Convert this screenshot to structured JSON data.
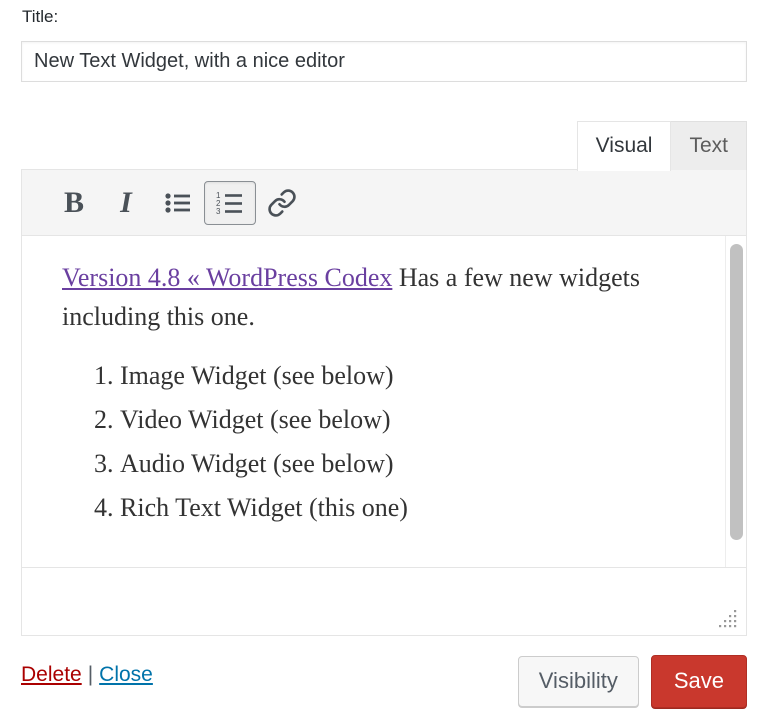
{
  "title_field": {
    "label": "Title:",
    "value": "New Text Widget, with a nice editor",
    "placeholder": "Title"
  },
  "tabs": [
    {
      "label": "Visual",
      "active": true,
      "name": "tab-visual"
    },
    {
      "label": "Text",
      "active": false,
      "name": "tab-text"
    }
  ],
  "toolbar": {
    "bold": {
      "label": "B",
      "icon": "bold-icon",
      "active": false
    },
    "italic": {
      "label": "I",
      "icon": "italic-icon",
      "active": false
    },
    "bullet_list": {
      "label": "",
      "icon": "unordered-list-icon",
      "active": false
    },
    "numbered_list": {
      "label": "",
      "icon": "ordered-list-icon",
      "active": true
    },
    "link": {
      "label": "",
      "icon": "link-icon",
      "active": false
    }
  },
  "editor": {
    "paragraph": {
      "link_text": "Version 4.8 « WordPress Codex",
      "rest_text": " Has a few new widgets including this one."
    },
    "list_items": [
      "Image Widget (see below)",
      "Video Widget (see below)",
      "Audio Widget (see below)",
      "Rich Text Widget (this one)"
    ],
    "resize_handle_icon": "resize-grip-icon",
    "scrollbar_icon": "vertical-scrollbar"
  },
  "footer": {
    "delete_label": "Delete",
    "separator": "|",
    "close_label": "Close",
    "visibility_label": "Visibility",
    "save_label": "Save"
  },
  "colors": {
    "save_button": "#c9382d",
    "delete_link": "#aa0000",
    "close_link": "#0073aa",
    "content_link": "#6a3fa0",
    "toolbar_bg": "#f5f5f5",
    "border": "#e5e5e5"
  }
}
